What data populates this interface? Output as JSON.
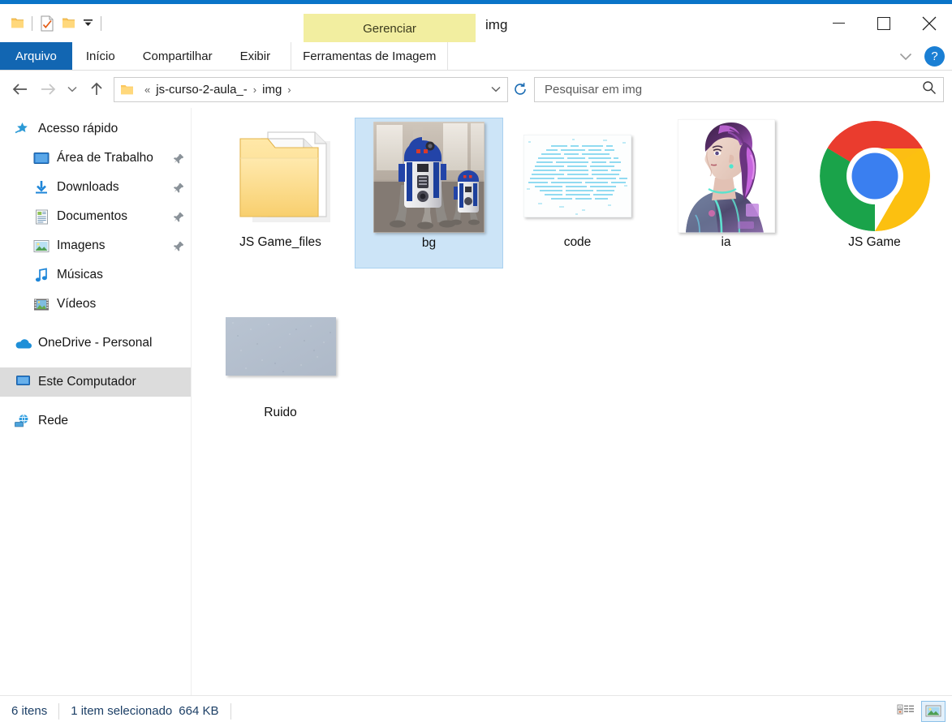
{
  "window": {
    "title": "img",
    "contextual_tab_group": "Gerenciar",
    "minimize_icon": "minimize-icon",
    "maximize_icon": "maximize-icon",
    "close_icon": "close-icon"
  },
  "quick_access": {
    "items": [
      {
        "name": "folder-icon",
        "label": "Propriedades da pasta"
      },
      {
        "name": "properties-icon",
        "label": "Propriedades"
      },
      {
        "name": "new-folder-icon",
        "label": "Nova pasta"
      },
      {
        "name": "customize-caret-icon",
        "label": "Personalizar Barra de Ferramentas de Acesso Rápido"
      }
    ]
  },
  "ribbon": {
    "tabs": [
      {
        "label": "Arquivo",
        "active": true
      },
      {
        "label": "Início",
        "active": false
      },
      {
        "label": "Compartilhar",
        "active": false
      },
      {
        "label": "Exibir",
        "active": false
      }
    ],
    "contextual_tab": "Ferramentas de Imagem",
    "collapse_icon": "chevron-down-icon",
    "help_label": "?"
  },
  "navigation": {
    "back_icon": "arrow-left-icon",
    "forward_icon": "arrow-right-icon",
    "recent_icon": "chevron-down-icon",
    "up_icon": "arrow-up-icon",
    "refresh_icon": "refresh-icon",
    "dropdown_icon": "chevron-down-icon",
    "breadcrumb": {
      "overflow": "«",
      "segments": [
        "js-curso-2-aula_-",
        "img"
      ],
      "separator": "›"
    }
  },
  "search": {
    "placeholder": "Pesquisar em img",
    "value": "",
    "icon": "search-icon"
  },
  "sidebar": {
    "items": [
      {
        "label": "Acesso rápido",
        "icon": "quick-access-star-icon",
        "level": 0,
        "pinned": false,
        "selected": false
      },
      {
        "label": "Área de Trabalho",
        "icon": "desktop-icon",
        "level": 1,
        "pinned": true,
        "selected": false
      },
      {
        "label": "Downloads",
        "icon": "downloads-icon",
        "level": 1,
        "pinned": true,
        "selected": false
      },
      {
        "label": "Documentos",
        "icon": "documents-icon",
        "level": 1,
        "pinned": true,
        "selected": false
      },
      {
        "label": "Imagens",
        "icon": "pictures-icon",
        "level": 1,
        "pinned": true,
        "selected": false
      },
      {
        "label": "Músicas",
        "icon": "music-icon",
        "level": 1,
        "pinned": false,
        "selected": false
      },
      {
        "label": "Vídeos",
        "icon": "videos-icon",
        "level": 1,
        "pinned": false,
        "selected": false
      },
      {
        "label": "OneDrive - Personal",
        "icon": "onedrive-icon",
        "level": 0,
        "pinned": false,
        "selected": false
      },
      {
        "label": "Este Computador",
        "icon": "this-pc-icon",
        "level": 0,
        "pinned": false,
        "selected": true
      },
      {
        "label": "Rede",
        "icon": "network-icon",
        "level": 0,
        "pinned": false,
        "selected": false
      }
    ]
  },
  "files": [
    {
      "name": "JS Game_files",
      "type": "folder",
      "thumb": "folder-thumb",
      "selected": false
    },
    {
      "name": "bg",
      "type": "image",
      "thumb": "r2d2-photo-thumb",
      "selected": true
    },
    {
      "name": "code",
      "type": "image",
      "thumb": "code-matrix-thumb",
      "selected": false
    },
    {
      "name": "ia",
      "type": "image",
      "thumb": "cyberpunk-portrait-thumb",
      "selected": false
    },
    {
      "name": "JS Game",
      "type": "shortcut",
      "thumb": "chrome-icon",
      "selected": false
    },
    {
      "name": "Ruido",
      "type": "image",
      "thumb": "noise-gray-thumb",
      "selected": false
    }
  ],
  "status": {
    "item_count": "6 itens",
    "selection": "1 item selecionado",
    "selection_size": "664 KB"
  },
  "view_toggle": {
    "details_view": "details-view-icon",
    "large_icons_view": "large-icons-view-icon",
    "active": "large_icons_view"
  },
  "colors": {
    "title_stripe": "#0a74c8",
    "file_tab": "#1266b2",
    "contextual_tab": "#f2eea0",
    "selection": "#cce4f7",
    "sidebar_selection": "#dcdcdc",
    "status_text": "#1c3f66"
  }
}
